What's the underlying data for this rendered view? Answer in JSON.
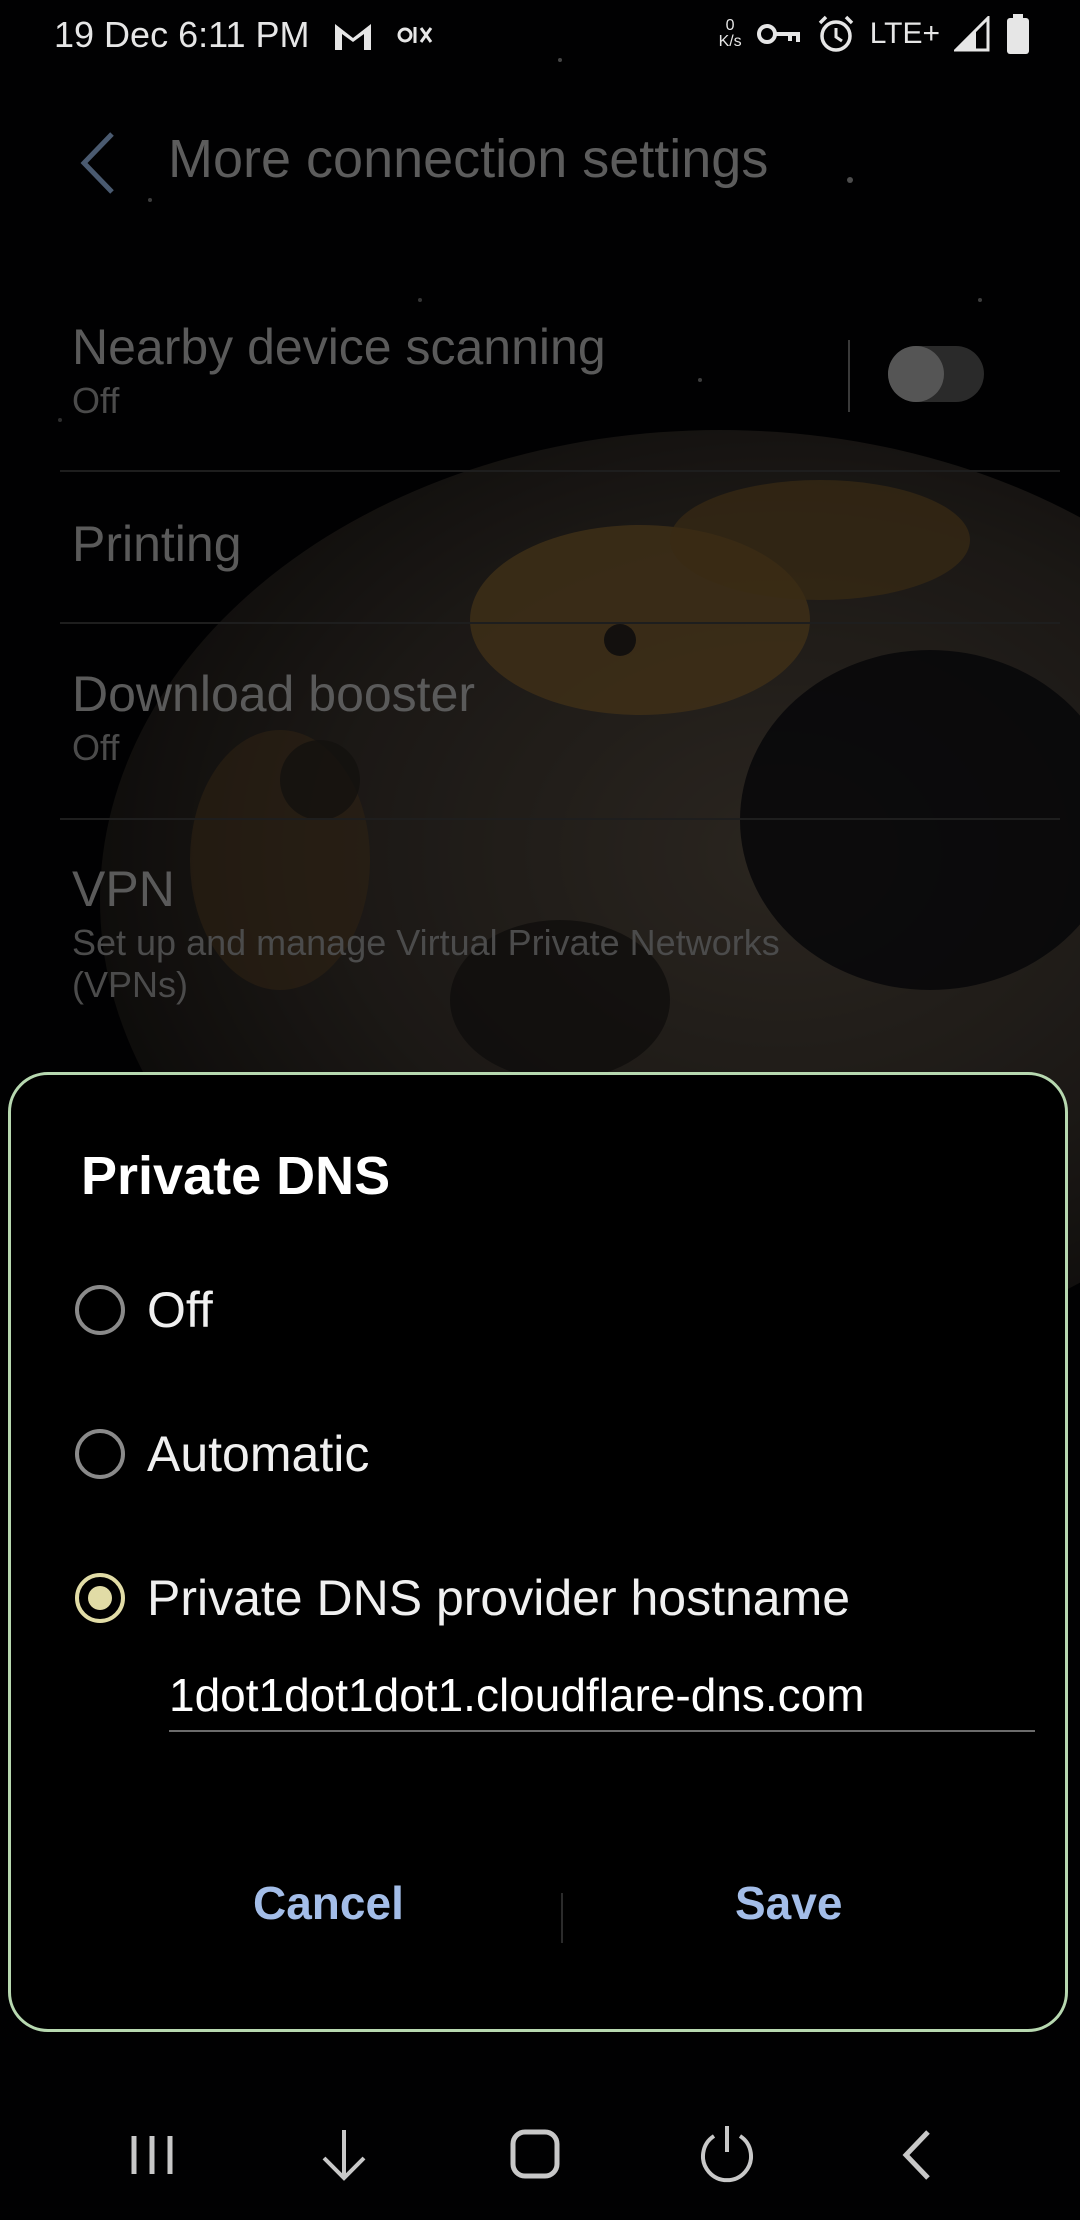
{
  "status_bar": {
    "datetime": "19 Dec 6:11 PM",
    "net_speed_value": "0",
    "net_speed_unit": "K/s",
    "network": "LTE+",
    "icons": [
      "gmail-icon",
      "olx-icon",
      "vpn-key-icon",
      "alarm-icon",
      "signal-icon",
      "battery-icon"
    ]
  },
  "header": {
    "title": "More connection settings"
  },
  "settings": {
    "nearby": {
      "title": "Nearby device scanning",
      "sub": "Off",
      "toggle_on": false
    },
    "printing": {
      "title": "Printing"
    },
    "download": {
      "title": "Download booster",
      "sub": "Off"
    },
    "vpn": {
      "title": "VPN",
      "sub_line1": "Set up and manage Virtual Private Networks",
      "sub_line2": "(VPNs)"
    }
  },
  "dialog": {
    "title": "Private DNS",
    "options": [
      {
        "label": "Off",
        "selected": false
      },
      {
        "label": "Automatic",
        "selected": false
      },
      {
        "label": "Private DNS provider hostname",
        "selected": true
      }
    ],
    "hostname_value": "1dot1dot1dot1.cloudflare-dns.com",
    "cancel_label": "Cancel",
    "save_label": "Save",
    "accent_color": "#e1dca6",
    "border_color": "#b7d8b0",
    "button_color": "#a3bde8"
  },
  "navbar": {
    "icons": [
      "recents-icon",
      "collapse-icon",
      "home-icon",
      "power-icon",
      "back-icon"
    ]
  }
}
